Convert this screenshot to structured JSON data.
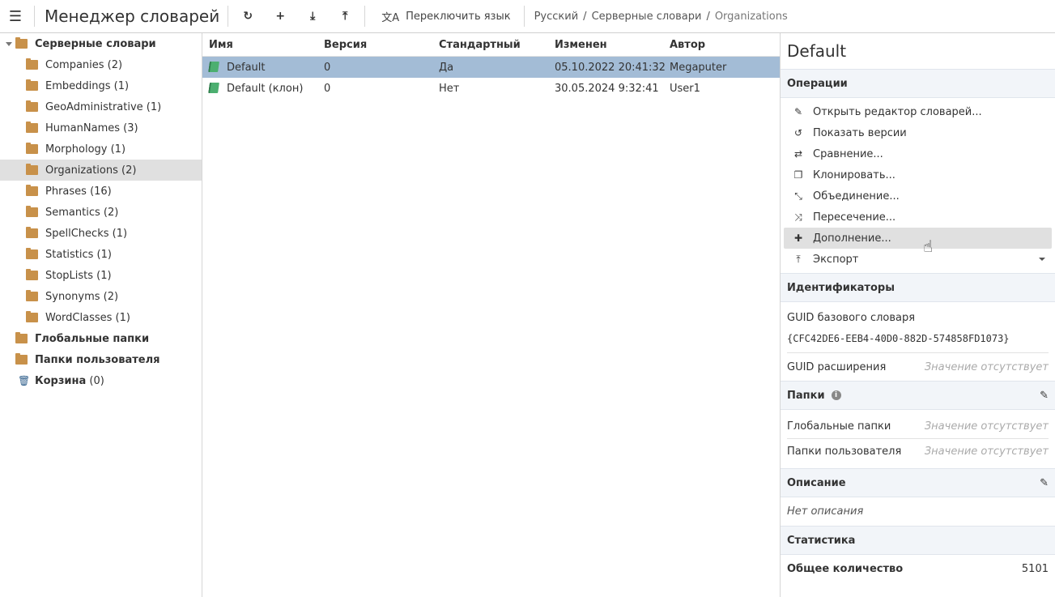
{
  "toolbar": {
    "title": "Менеджер словарей",
    "switch_lang": "Переключить язык",
    "breadcrumb": [
      "Русский",
      "Серверные словари",
      "Organizations"
    ]
  },
  "sidebar": {
    "root": "Серверные словари",
    "children": [
      "Companies (2)",
      "Embeddings (1)",
      "GeoAdministrative (1)",
      "HumanNames (3)",
      "Morphology (1)",
      "Organizations (2)",
      "Phrases (16)",
      "Semantics (2)",
      "SpellChecks (1)",
      "Statistics (1)",
      "StopLists (1)",
      "Synonyms (2)",
      "WordClasses (1)"
    ],
    "selected": "Organizations (2)",
    "global": "Глобальные папки",
    "user": "Папки пользователя",
    "trash": "Корзина",
    "trash_count": "(0)"
  },
  "table": {
    "columns": [
      "Имя",
      "Версия",
      "Стандартный",
      "Изменен",
      "Автор"
    ],
    "rows": [
      [
        "Default",
        "0",
        "Да",
        "05.10.2022 20:41:32",
        "Megaputer"
      ],
      [
        "Default (клон)",
        "0",
        "Нет",
        "30.05.2024 9:32:41",
        "User1"
      ]
    ],
    "selected_row": 0
  },
  "panel": {
    "title": "Default",
    "operations_title": "Операции",
    "operations": [
      {
        "label": "Открыть редактор словарей...",
        "icon": "pencil-icon"
      },
      {
        "label": "Показать версии",
        "icon": "history-icon"
      },
      {
        "label": "Сравнение...",
        "icon": "compare-icon"
      },
      {
        "label": "Клонировать...",
        "icon": "clone-icon"
      },
      {
        "label": "Объединение...",
        "icon": "merge-icon"
      },
      {
        "label": "Пересечение...",
        "icon": "shuffle-icon"
      },
      {
        "label": "Дополнение...",
        "icon": "puzzle-icon"
      },
      {
        "label": "Экспорт",
        "icon": "upload-icon"
      }
    ],
    "ids_title": "Идентификаторы",
    "base_guid_label": "GUID базового словаря",
    "base_guid": "{CFC42DE6-EEB4-40D0-882D-574858FD1073}",
    "ext_guid_label": "GUID расширения",
    "missing": "Значение отсутствует",
    "folders_title": "Папки",
    "global_label": "Глобальные папки",
    "user_label": "Папки пользователя",
    "desc_title": "Описание",
    "desc": "Нет описания",
    "stats_title": "Статистика",
    "total_label": "Общее количество",
    "total": "5101"
  },
  "colors": {
    "selection": "#a3bcd6",
    "folder": "#c8914a",
    "book": "#4caf70"
  }
}
